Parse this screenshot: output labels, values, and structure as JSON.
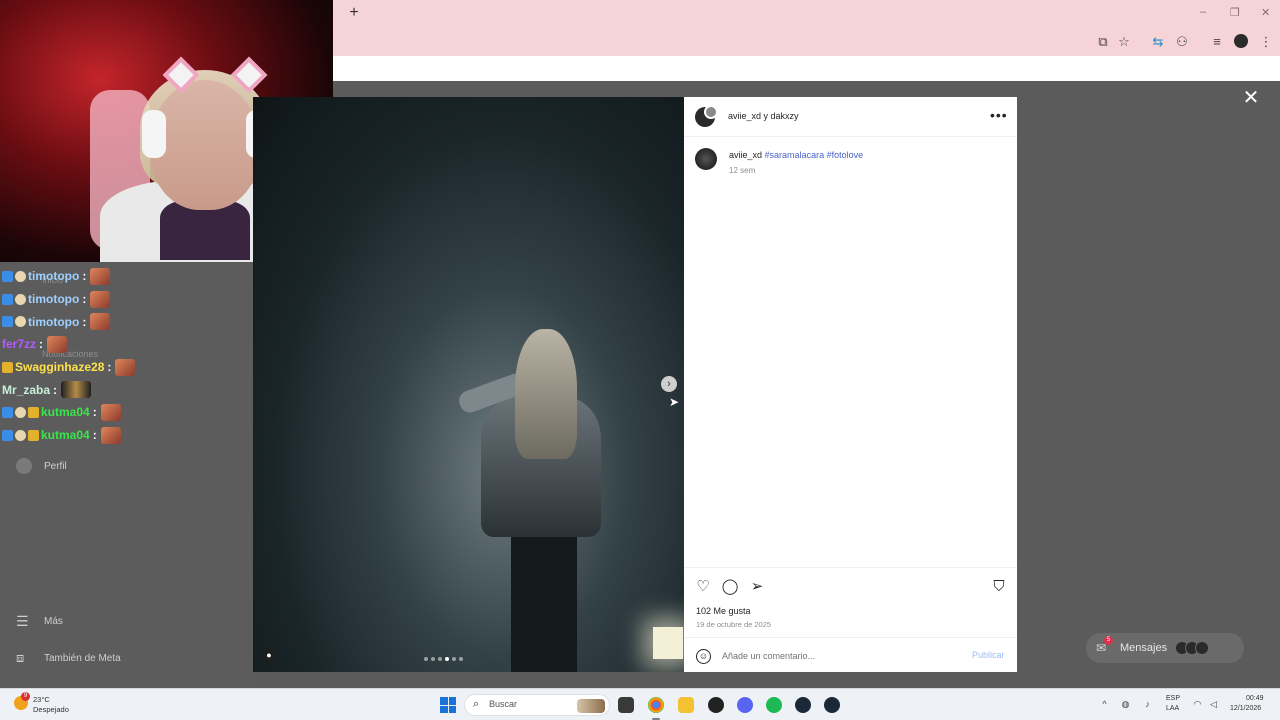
{
  "browser": {
    "new_tab_glyph": "+",
    "window_controls": [
      "–",
      "❐",
      "✕"
    ]
  },
  "sidebar": {
    "items": [
      {
        "label": "Más",
        "icon": "menu-icon"
      },
      {
        "label": "También de Meta",
        "icon": "meta-icon"
      },
      {
        "label": "Perfil",
        "icon": "avatar-icon"
      }
    ],
    "ghost_labels": [
      "Inicio",
      "Notificaciones"
    ]
  },
  "chat": {
    "messages": [
      {
        "user": "timotopo",
        "color": "#9fd0ff",
        "badges": [
          "blue",
          "round"
        ],
        "emote": "cat"
      },
      {
        "user": "timotopo",
        "color": "#9fd0ff",
        "badges": [
          "blue",
          "round"
        ],
        "emote": "cat"
      },
      {
        "user": "timotopo",
        "color": "#9fd0ff",
        "badges": [
          "blue",
          "round"
        ],
        "emote": "cat"
      },
      {
        "user": "fer7zz",
        "color": "#b25cff",
        "badges": [],
        "emote": "cat"
      },
      {
        "user": "Swagginhaze28",
        "color": "#ffe14d",
        "badges": [
          "gold"
        ],
        "emote": "cat"
      },
      {
        "user": "Mr_zaba",
        "color": "#c8f0d8",
        "badges": [],
        "emote": "dark"
      },
      {
        "user": "kutma04",
        "color": "#39e64a",
        "badges": [
          "blue",
          "round",
          "gold"
        ],
        "emote": "cat"
      },
      {
        "user": "kutma04",
        "color": "#39e64a",
        "badges": [
          "blue",
          "round",
          "gold"
        ],
        "emote": "cat"
      }
    ],
    "colon": ":"
  },
  "post": {
    "header_title": "aviie_xd y dakxzy",
    "more_glyph": "•••",
    "caption_user": "aviie_xd",
    "caption_tags": "#saramalacara #fotolove",
    "caption_time": "12 sem",
    "likes": "102 Me gusta",
    "date": "19 de octubre de 2025",
    "comment_placeholder": "Añade un comentario...",
    "publish_label": "Publicar",
    "carousel_dots": 6,
    "carousel_active": 3
  },
  "icons": {
    "close": "✕",
    "next": "›",
    "like": "♡",
    "comment": "◯",
    "share": "➢",
    "save": "⛉",
    "emoji": "☺",
    "tag_user": "●"
  },
  "messages_pill": {
    "label": "Mensajes",
    "badge": "5"
  },
  "taskbar": {
    "weather_temp": "23°C",
    "weather_desc": "Despejado",
    "weather_badge": "9",
    "search_placeholder": "Buscar",
    "lang_top": "ESP",
    "lang_bottom": "LAA",
    "time": "00:49",
    "date": "12/1/2026",
    "tray_chevron": "^"
  },
  "colors": {
    "browser_chrome": "#f6d3d6",
    "hashtag": "#4a63c9",
    "publish": "#9bbcf3"
  }
}
